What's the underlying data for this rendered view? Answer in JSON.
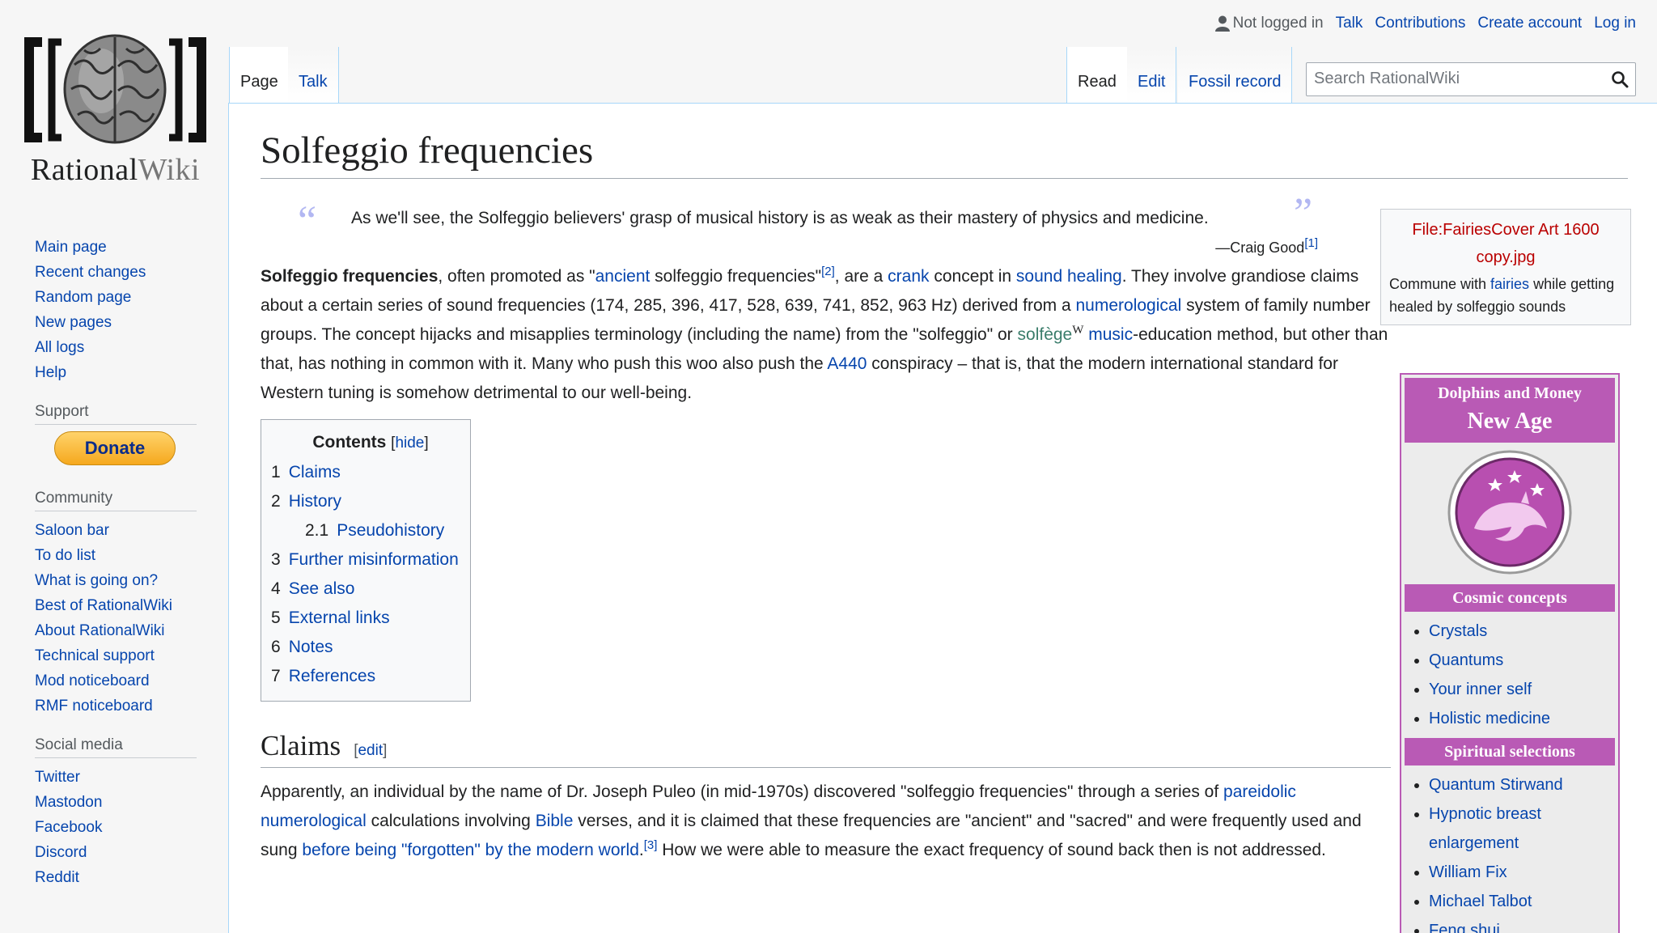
{
  "logo": {
    "brand_main": "Rational",
    "brand_suffix": "Wiki"
  },
  "personal": {
    "not_logged_in": "Not logged in",
    "talk": "Talk",
    "contributions": "Contributions",
    "create_account": "Create account",
    "log_in": "Log in"
  },
  "tabs": {
    "page": "Page",
    "talk": "Talk",
    "read": "Read",
    "edit": "Edit",
    "fossil": "Fossil record"
  },
  "search": {
    "placeholder": "Search RationalWiki"
  },
  "sidebar": {
    "nav": [
      "Main page",
      "Recent changes",
      "Random page",
      "New pages",
      "All logs",
      "Help"
    ],
    "support_heading": "Support",
    "donate": "Donate",
    "community_heading": "Community",
    "community": [
      "Saloon bar",
      "To do list",
      "What is going on?",
      "Best of RationalWiki",
      "About RationalWiki",
      "Technical support",
      "Mod noticeboard",
      "RMF noticeboard"
    ],
    "social_heading": "Social media",
    "social": [
      "Twitter",
      "Mastodon",
      "Facebook",
      "Discord",
      "Reddit"
    ]
  },
  "article": {
    "title": "Solfeggio frequencies",
    "quote": {
      "text": "As we'll see, the Solfeggio believers' grasp of musical history is as weak as their mastery of physics and medicine.",
      "cite": "—Craig Good",
      "ref": "[1]"
    },
    "intro": {
      "bold": "Solfeggio frequencies",
      "t1": ", often promoted as \"",
      "l_ancient": "ancient",
      "t2": " solfeggio frequencies\"",
      "ref2": "[2]",
      "t3": ", are a ",
      "l_crank": "crank",
      "t4": " concept in ",
      "l_sound": "sound healing",
      "t5": ". They involve grandiose claims about a certain series of sound frequencies (174, 285, 396, 417, 528, 639, 741, 852, 963 Hz) derived from a ",
      "l_numer": "numerological",
      "t6": " system of family number groups. The concept hijacks and misapplies terminology (including the name) from the \"solfeggio\" or ",
      "l_solfege": "solfège",
      "w": "W",
      "l_music": "music",
      "t7": "-education method, but other than that, has nothing in common with it. Many who push this woo also push the ",
      "l_a440": "A440",
      "t8": " conspiracy – that is, that the modern international standard for Western tuning is somehow detrimental to our well-being."
    },
    "toc": {
      "title": "Contents",
      "hide": "hide",
      "items": [
        {
          "num": "1",
          "label": "Claims"
        },
        {
          "num": "2",
          "label": "History"
        },
        {
          "num": "2.1",
          "label": "Pseudohistory"
        },
        {
          "num": "3",
          "label": "Further misinformation"
        },
        {
          "num": "4",
          "label": "See also"
        },
        {
          "num": "5",
          "label": "External links"
        },
        {
          "num": "6",
          "label": "Notes"
        },
        {
          "num": "7",
          "label": "References"
        }
      ]
    },
    "claims": {
      "heading": "Claims",
      "edit": "edit",
      "t1": "Apparently, an individual by the name of Dr. Joseph Puleo (in mid-1970s) discovered \"solfeggio frequencies\" through a series of ",
      "l_pareidolic": "pareidolic",
      "l_numer": "numerological",
      "t2": " calculations involving ",
      "l_bible": "Bible",
      "t3": " verses, and it is claimed that these frequencies are \"ancient\" and \"sacred\" and were frequently used and sung ",
      "l_forgotten": "before being \"forgotten\" by the modern world",
      "t4": ".",
      "ref3": "[3]",
      "t5": " How we were able to measure the exact frequency of sound back then is not addressed."
    }
  },
  "filebox": {
    "name": "File:FairiesCover Art 1600 copy.jpg",
    "cap1": "Commune with ",
    "cap_link": "fairies",
    "cap2": " while getting healed by solfeggio sounds"
  },
  "navbox": {
    "title1": "Dolphins and Money",
    "title2": "New Age",
    "sec1": "Cosmic concepts",
    "list1": [
      "Crystals",
      "Quantums",
      "Your inner self",
      "Holistic medicine"
    ],
    "sec2": "Spiritual selections",
    "list2": [
      "Quantum Stirwand",
      "Hypnotic breast enlargement",
      "William Fix",
      "Michael Talbot",
      "Feng shui"
    ]
  },
  "colors": {
    "link": "#0645ad",
    "redlink": "#ba0000",
    "navbox": "#b95ab5",
    "tab_border": "#a7d7f9"
  }
}
